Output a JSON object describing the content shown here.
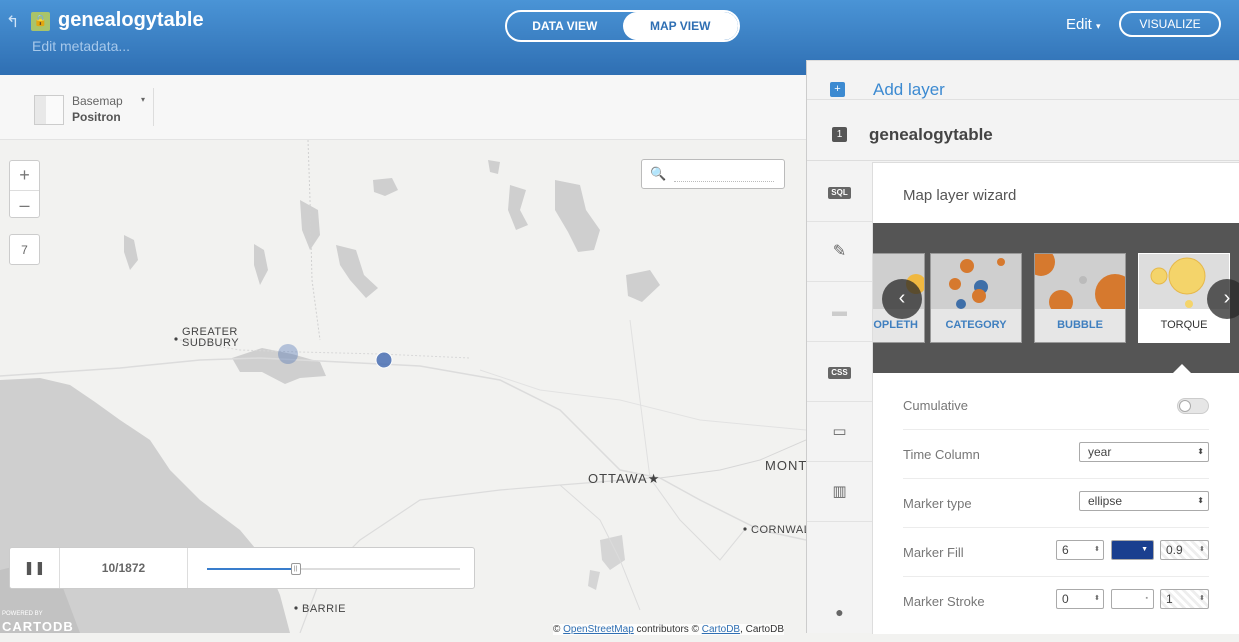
{
  "header": {
    "back_icon": "back-arrow-icon",
    "lock_icon": "lock-icon",
    "title": "genealogytable",
    "edit_metadata": "Edit metadata...",
    "view_toggle": {
      "data_view": "DATA VIEW",
      "map_view": "MAP VIEW",
      "active": "MAP VIEW"
    },
    "edit_label": "Edit",
    "edit_caret": "▾",
    "visualize_label": "VISUALIZE"
  },
  "basemap": {
    "label": "Basemap",
    "value": "Positron",
    "caret": "▾"
  },
  "map": {
    "zoom_in": "+",
    "zoom_out": "–",
    "zoom_level": "7",
    "search_icon": "search-icon",
    "places": {
      "greater": "GREATER",
      "sudbury": "SUDBURY",
      "ottawa": "OTTAWA",
      "mont": "MONT",
      "cornwall": "CORNWALL",
      "barrie": "BARRIE"
    },
    "marker_color": "#3f67b0"
  },
  "timeline": {
    "pause_icon": "pause-icon",
    "frame": "10/1872",
    "progress": 0.35
  },
  "branding": {
    "powered_by": "POWERED BY",
    "logo": "CARTODB"
  },
  "attribution": {
    "prefix": "©",
    "osm": "OpenStreetMap",
    "mid": "contributors ©",
    "cartodb": "CartoDB",
    "suffix": ", CartoDB"
  },
  "panel": {
    "add_layer": "Add layer",
    "add_icon": "plus-icon",
    "layer_number": "1",
    "layer_name": "genealogytable",
    "tabs": {
      "sql": "SQL",
      "css": "CSS"
    },
    "wizard_title": "Map layer wizard",
    "cards": [
      "OPLETH",
      "CATEGORY",
      "BUBBLE",
      "TORQUE"
    ],
    "selected_card": "TORQUE",
    "prev_arrow": "‹",
    "next_arrow": "›",
    "rows": {
      "cumulative": {
        "label": "Cumulative",
        "value": false
      },
      "time_column": {
        "label": "Time Column",
        "value": "year"
      },
      "marker_type": {
        "label": "Marker type",
        "value": "ellipse"
      },
      "marker_fill": {
        "label": "Marker Fill",
        "size": "6",
        "color": "#1a3f8f",
        "opacity": "0.9"
      },
      "marker_stroke": {
        "label": "Marker Stroke",
        "width": "0",
        "opacity": "1"
      }
    }
  }
}
